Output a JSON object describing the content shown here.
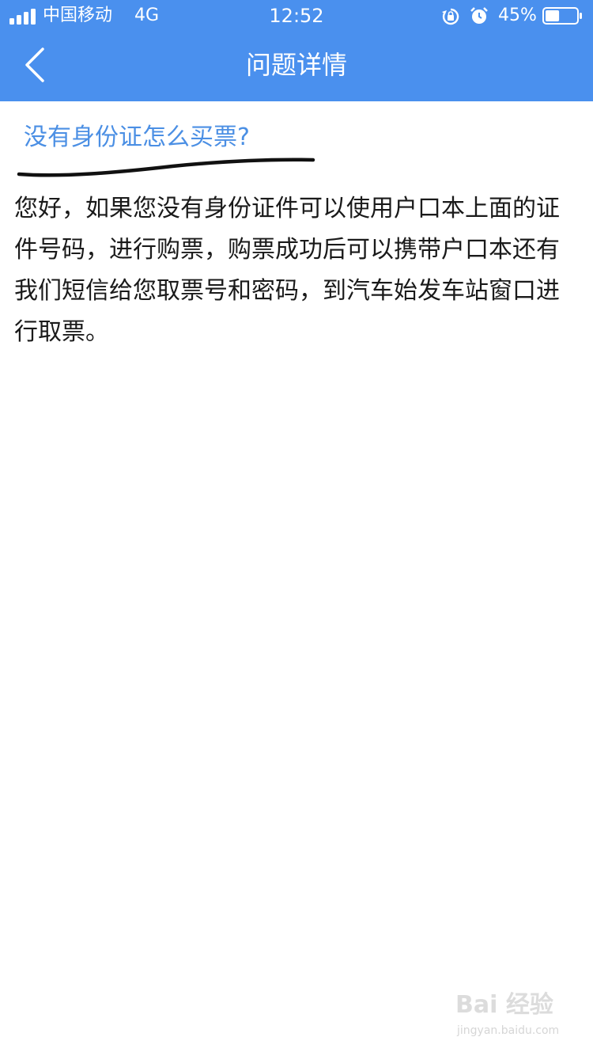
{
  "status_bar": {
    "carrier": "中国移动",
    "network": "4G",
    "time": "12:52",
    "battery_percent": "45%",
    "battery_level": 0.45
  },
  "nav": {
    "title": "问题详情",
    "back_icon": "chevron-left-icon"
  },
  "question": {
    "title": "没有身份证怎么买票?"
  },
  "answer": {
    "text": "您好，如果您没有身份证件可以使用户口本上面的证件号码，进行购票，购票成功后可以携带户口本还有我们短信给您取票号和密码，到汽车始发车站窗口进行取票。"
  },
  "watermark": {
    "brand": "Bai 经验",
    "url": "jingyan.baidu.com"
  },
  "colors": {
    "header_bg": "#4a90ee",
    "title_blue": "#4b8fe4",
    "text": "#1a1a1a"
  }
}
